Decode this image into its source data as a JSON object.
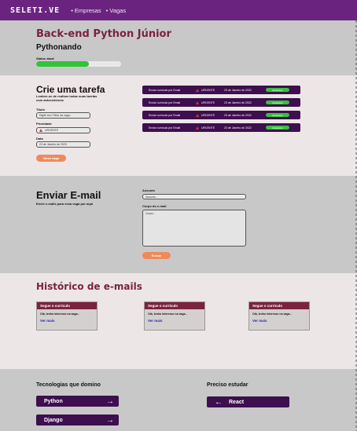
{
  "nav": {
    "brand": "SELETI.VE",
    "links": [
      "• Empresas",
      "• Vagas"
    ]
  },
  "job": {
    "title": "Back-end Python Júnior",
    "company": "Pythonando",
    "status_label": "Status atual",
    "status_progress": 0.62
  },
  "tasks": {
    "title": "Crie uma tarefa",
    "subtitle": "Lembre-se de realizar todas suas tarefas com antecedencia",
    "title_label": "Título",
    "title_placeholder": "Digite seu Título da vaga...",
    "priority_label": "Prioridade",
    "priority_value": "URGENTE",
    "date_label": "Data",
    "date_value": "23 de Janeiro de 2023",
    "submit": "Nova vaga",
    "items": [
      {
        "text": "Enviar currículo por Email",
        "priority": "URGENTE",
        "date": "23 de Janeiro de 2022",
        "status": "Realizado"
      },
      {
        "text": "Enviar currículo por Email",
        "priority": "URGENTE",
        "date": "23 de Janeiro de 2022",
        "status": "Realizado"
      },
      {
        "text": "Enviar currículo por Email",
        "priority": "URGENTE",
        "date": "23 de Janeiro de 2022",
        "status": "Realizado"
      },
      {
        "text": "Enviar currículo por Email",
        "priority": "URGENTE",
        "date": "23 de Janeiro de 2022",
        "status": "Realizado"
      }
    ]
  },
  "email": {
    "title": "Enviar E-mail",
    "subtitle": "Envie e-mails para essa vaga por aqui",
    "subject_label": "Assunto",
    "subject_placeholder": "Assunto...",
    "body_label": "Corpo do e-mail",
    "body_placeholder": "Corpo...",
    "submit": "Enviar"
  },
  "history": {
    "title": "Histórico de e-mails",
    "cards": [
      {
        "subject": "Segue o currículo",
        "preview": "Olá, tenho interesse na vaga...",
        "link": "Ver mais"
      },
      {
        "subject": "Segue o currículo",
        "preview": "Olá, tenho interesse na vaga...",
        "link": "Ver mais"
      },
      {
        "subject": "Segue o currículo",
        "preview": "Olá, tenho interesse na vaga...",
        "link": "Ver mais"
      }
    ]
  },
  "tech": {
    "known_title": "Tecnologias que domino",
    "known": [
      "Python",
      "Django"
    ],
    "study_title": "Preciso estudar",
    "study": [
      "React"
    ],
    "arrow_right": "→",
    "arrow_left": "←"
  },
  "colors": {
    "primary": "#6b2380",
    "dark": "#3d0f4e",
    "accent": "#7a2340",
    "success": "#33c33a",
    "orange": "#ee8a5a"
  }
}
